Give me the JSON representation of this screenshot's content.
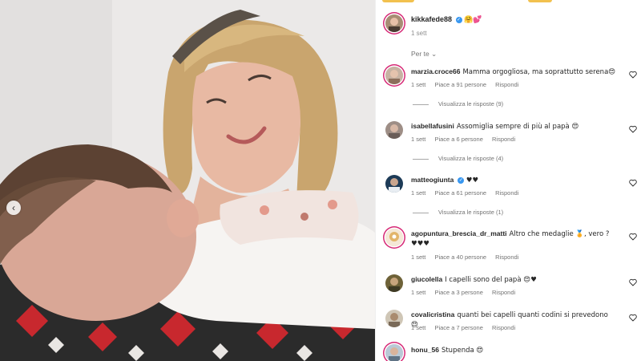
{
  "post": {
    "author": "kikkafede88",
    "caption_emojis": "🤗💕",
    "time": "1 sett",
    "sort_label": "Per te",
    "sort_arrow": "⌄"
  },
  "photo": {
    "nav_icon": "‹"
  },
  "comments": [
    {
      "user": "marzia.croce66",
      "text": "Mamma orgogliosa, ma soprattutto serena😍",
      "time": "1 sett",
      "likes": "Piace a 91 persone",
      "reply": "Rispondi",
      "replies": "Visualizza le risposte (9)"
    },
    {
      "user": "isabellafusini",
      "text": "Assomiglia sempre di più al papà 😍",
      "time": "1 sett",
      "likes": "Piace a 6 persone",
      "reply": "Rispondi",
      "replies": "Visualizza le risposte (4)"
    },
    {
      "user": "matteogiunta",
      "verified": "✓",
      "text": "♥♥",
      "time": "1 sett",
      "likes": "Piace a 61 persone",
      "reply": "Rispondi",
      "replies": "Visualizza le risposte (1)"
    },
    {
      "user": "agopuntura_brescia_dr_matti",
      "text": "Altro che medaglie 🏅, vero ? ♥♥♥",
      "time": "1 sett",
      "likes": "Piace a 40 persone",
      "reply": "Rispondi"
    },
    {
      "user": "giucolella",
      "text": "I capelli sono del papà 😍♥",
      "time": "1 sett",
      "likes": "Piace a 3 persone",
      "reply": "Rispondi"
    },
    {
      "user": "covalicristina",
      "text": "quanti bei capelli quanti codini si prevedono 😍",
      "time": "1 sett",
      "likes": "Piace a 7 persone",
      "reply": "Rispondi"
    },
    {
      "user": "honu_56",
      "text": "Stupenda 😍"
    }
  ],
  "colors": {
    "accent_ring": "#d62976",
    "verified": "#3897f0",
    "muted": "#737373"
  },
  "icons": {
    "heart": "heart-outline-icon",
    "verified": "verified-badge-icon"
  }
}
